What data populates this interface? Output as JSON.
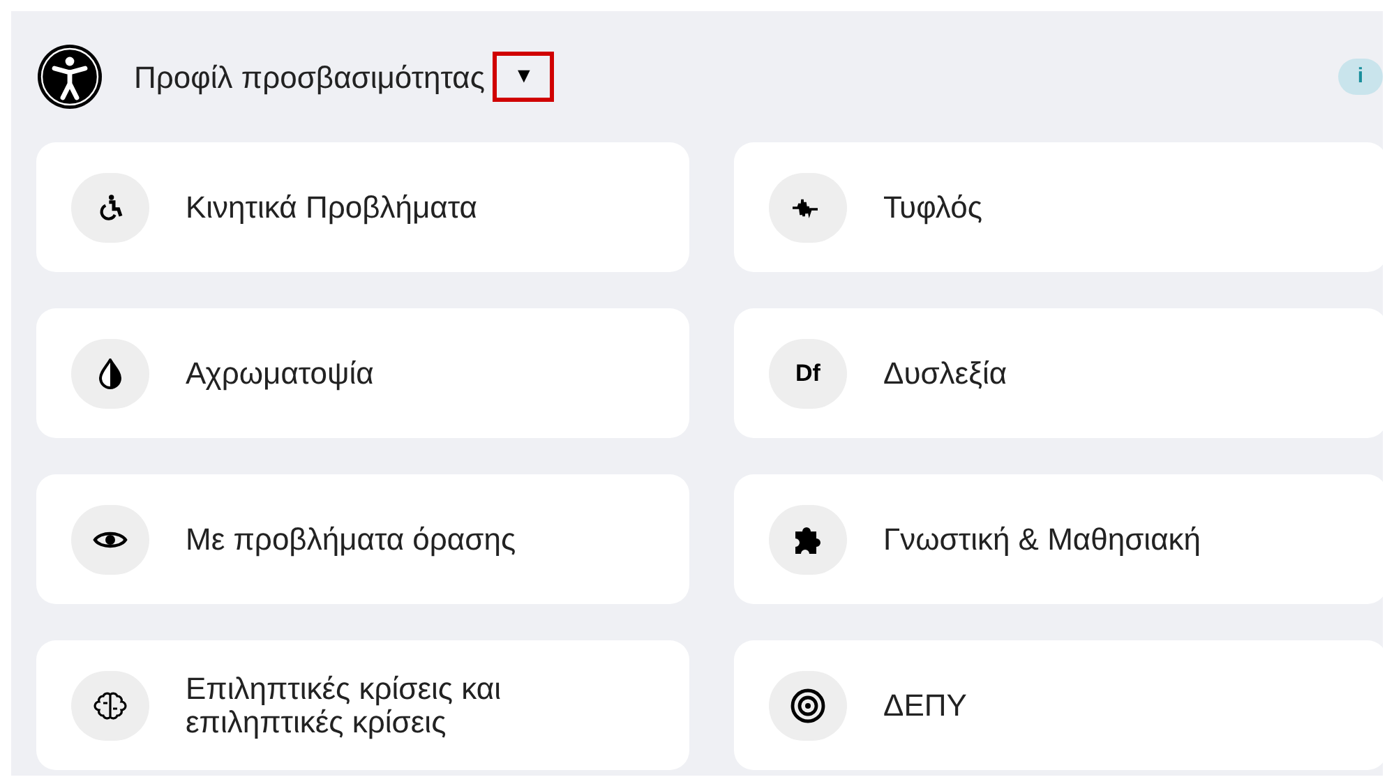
{
  "header": {
    "title": "Προφίλ προσβασιμότητας",
    "dropdown_caret": "▼",
    "info": "i"
  },
  "profiles": [
    {
      "label": "Κινητικά Προβλήματα"
    },
    {
      "label": "Τυφλός"
    },
    {
      "label": "Αχρωματοψία"
    },
    {
      "icon_text": "Df",
      "label": "Δυσλεξία"
    },
    {
      "label": "Με προβλήματα όρασης"
    },
    {
      "label": "Γνωστική & Μαθησιακή"
    },
    {
      "label": "Επιληπτικές κρίσεις και επιληπτικές κρίσεις"
    },
    {
      "label": "ΔΕΠΥ"
    }
  ]
}
